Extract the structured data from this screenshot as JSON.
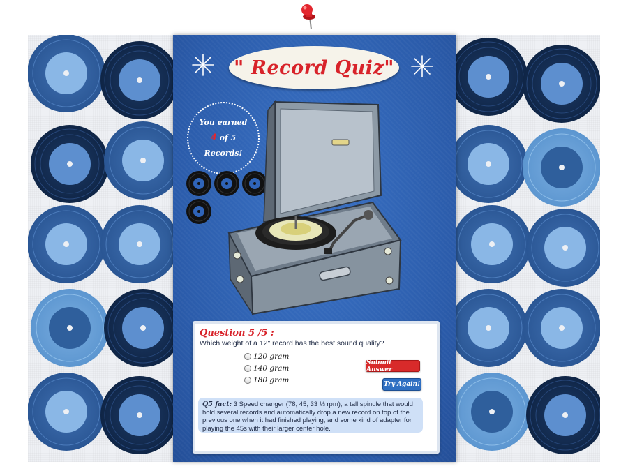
{
  "title": "\" Record Quiz\"",
  "score": {
    "line1": "You earned",
    "count": "4",
    "of_total": "of 5",
    "line3": "Records!"
  },
  "quiz": {
    "question_header": "Question 5 /5 :",
    "question_text": "Which weight of a 12\" record has the best sound quality?",
    "options": [
      "120 gram",
      "140 gram",
      "180 gram"
    ],
    "submit_label": "Submit Answer",
    "try_again_label": "Try Again!",
    "fact_label": "Q5 fact:",
    "fact_text": " 3 Speed changer (78, 45, 33 ⅓ rpm), a tall spindle that would hold several records and automatically drop a new record on top of the previous one when it had finished playing, and some kind of adapter for playing the 45s with their larger center hole."
  },
  "colors": {
    "panel_blue": "#2f64b8",
    "title_red": "#d8232a",
    "submit_red": "#d82a2a",
    "try_blue": "#2f6fc2",
    "fact_bg": "#cfe0f7"
  },
  "icons": [
    "pushpin-icon",
    "sparkle-icon",
    "vinyl-record-icon",
    "turntable-illustration"
  ]
}
